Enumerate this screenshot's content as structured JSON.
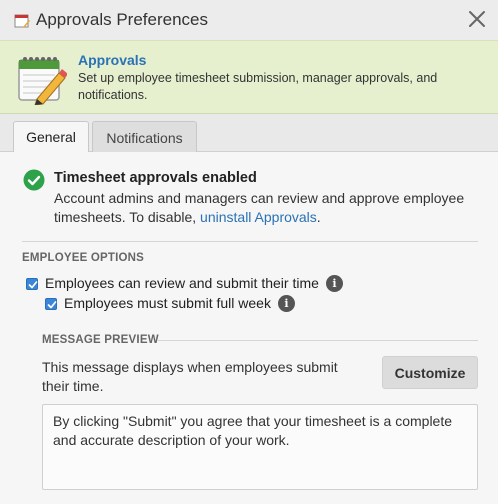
{
  "window": {
    "title": "Approvals Preferences"
  },
  "banner": {
    "title": "Approvals",
    "description": "Set up employee timesheet submission, manager approvals, and notifications."
  },
  "tabs": [
    {
      "label": "General"
    },
    {
      "label": "Notifications"
    }
  ],
  "status": {
    "title": "Timesheet approvals enabled",
    "description_before": "Account admins and managers can review and approve employee timesheets. To disable, ",
    "link": "uninstall Approvals",
    "description_after": "."
  },
  "employee_options": {
    "label": "EMPLOYEE OPTIONS",
    "options": [
      {
        "label": "Employees can review and submit their time",
        "checked": true
      },
      {
        "label": "Employees must submit full week",
        "checked": true
      }
    ]
  },
  "message_preview": {
    "label": "MESSAGE PREVIEW",
    "description": "This message displays when employees submit their time.",
    "customize_label": "Customize",
    "message": "By clicking \"Submit\" you agree that your timesheet is a complete and accurate description of your work."
  },
  "colors": {
    "accent": "#2a72b5",
    "banner_bg": "#e6f0cf",
    "success": "#2ea24a",
    "checkbox": "#3b86d8"
  }
}
